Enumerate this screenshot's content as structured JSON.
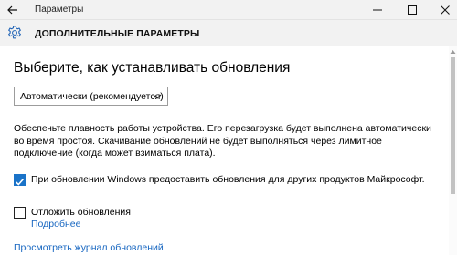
{
  "window": {
    "title": "Параметры",
    "back_icon": "arrow-left-icon",
    "controls": [
      "minimize-icon",
      "maximize-icon",
      "close-icon"
    ]
  },
  "header": {
    "icon": "gear-icon",
    "title": "ДОПОЛНИТЕЛЬНЫЕ ПАРАМЕТРЫ"
  },
  "main": {
    "heading": "Выберите, как устанавливать обновления",
    "install_mode": {
      "selected": "Автоматически (рекомендуется)"
    },
    "description": "Обеспечьте плавность работы устройства. Его перезагрузка будет выполнена автоматически во время простоя. Скачивание обновлений не будет выполняться через лимитное подключение (когда может взиматься плата).",
    "options": {
      "share_updates": {
        "label": "При обновлении Windows предоставить обновления для других продуктов Майкрософт.",
        "checked": true
      },
      "defer_updates": {
        "label": "Отложить обновления",
        "checked": false,
        "more_link": "Подробнее"
      }
    },
    "history_link": "Просмотреть журнал обновлений"
  },
  "colors": {
    "accent": "#1a73c8",
    "link": "#1565c0",
    "chrome": "#f2f2f2"
  }
}
